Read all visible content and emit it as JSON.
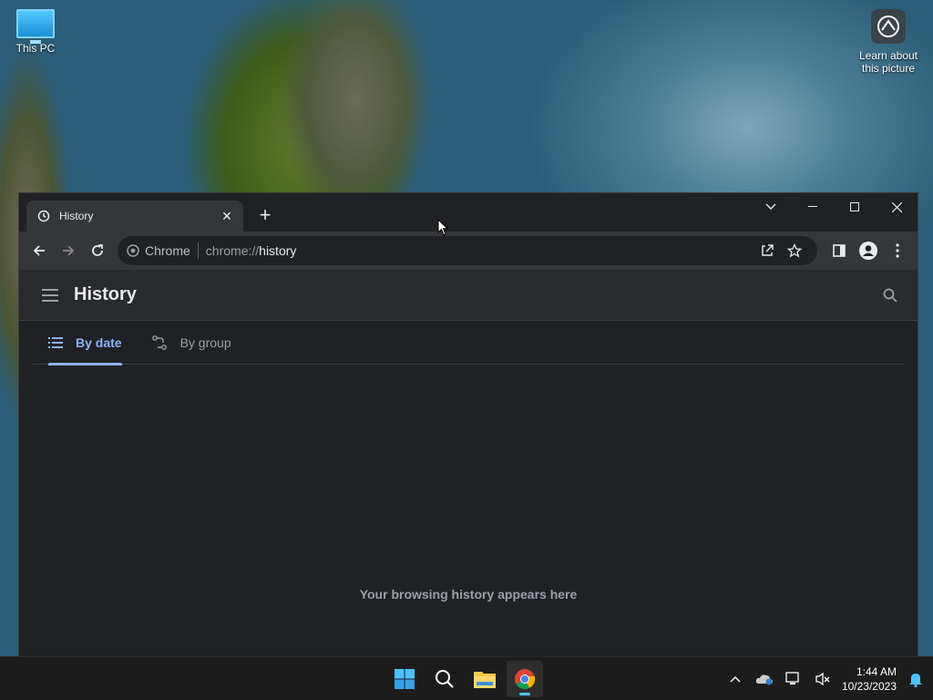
{
  "desktop": {
    "icons": [
      {
        "label": "This PC"
      },
      {
        "label": "Learn about this picture"
      }
    ]
  },
  "browser": {
    "tab": {
      "title": "History"
    },
    "omnibox": {
      "chip_label": "Chrome",
      "url_scheme": "chrome://",
      "url_path": "history"
    },
    "page": {
      "title": "History",
      "tabs": [
        {
          "label": "By date",
          "active": true
        },
        {
          "label": "By group",
          "active": false
        }
      ],
      "empty_message": "Your browsing history appears here"
    }
  },
  "taskbar": {
    "apps": [
      "windows-start",
      "search",
      "file-explorer",
      "chrome"
    ],
    "active_app": "chrome",
    "clock": {
      "time": "1:44 AM",
      "date": "10/23/2023"
    }
  },
  "colors": {
    "accent": "#8ab4f8",
    "window_bg": "#202124",
    "toolbar_bg": "#35363a",
    "taskbar_bg": "#1c1c1c"
  }
}
